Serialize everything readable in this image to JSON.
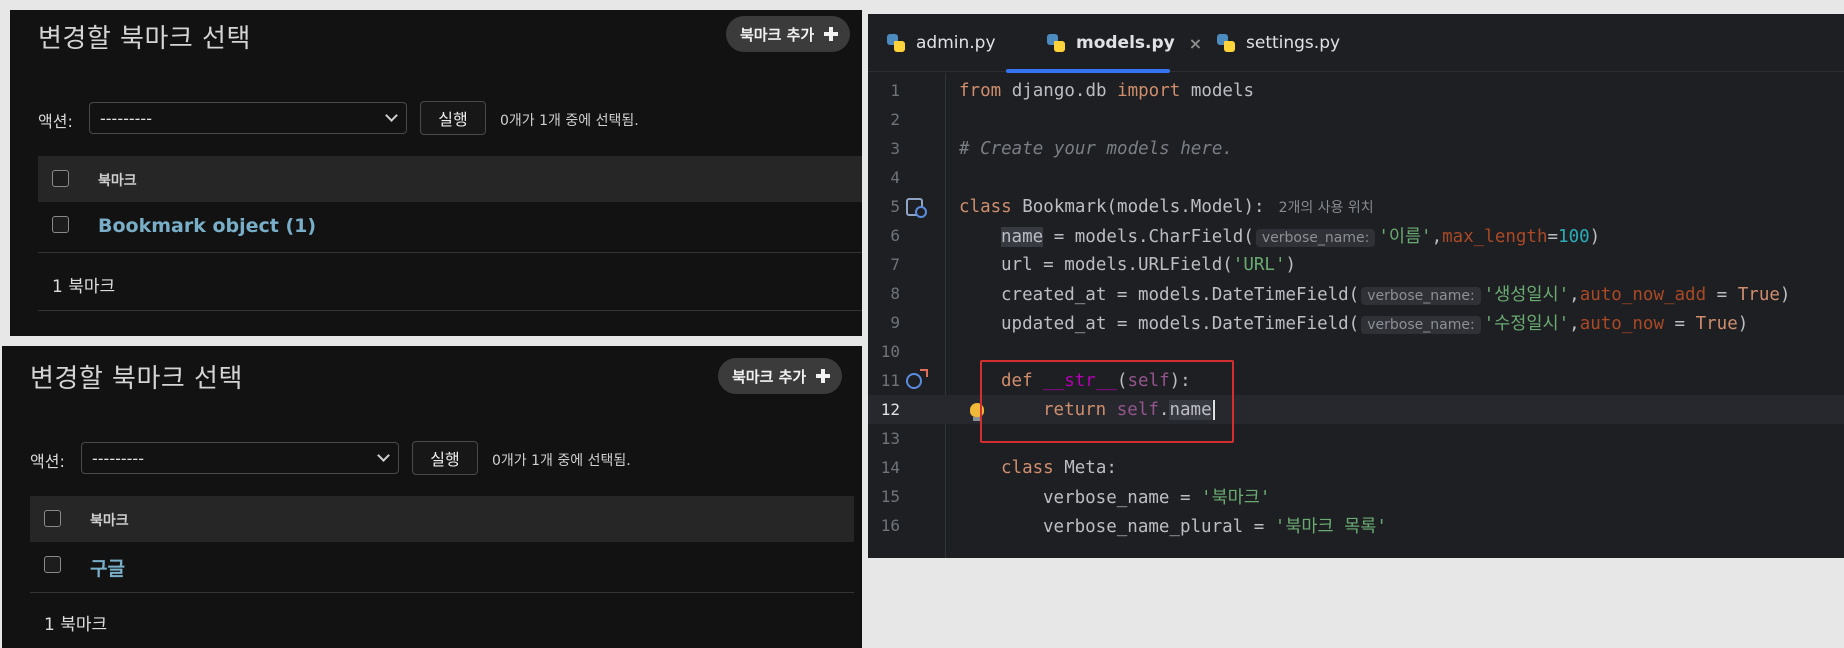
{
  "admin_top": {
    "title": "변경할 북마크 선택",
    "add_button": "북마크 추가",
    "action_label": "액션:",
    "action_value": "---------",
    "run_button": "실행",
    "selection_count": "0개가 1개 중에 선택됨.",
    "column_header": "북마크",
    "row": "Bookmark object (1)",
    "footer": "1 북마크"
  },
  "admin_bottom": {
    "title": "변경할 북마크 선택",
    "add_button": "북마크 추가",
    "action_label": "액션:",
    "action_value": "---------",
    "run_button": "실행",
    "selection_count": "0개가 1개 중에 선택됨.",
    "column_header": "북마크",
    "row": "구글",
    "footer": "1 북마크"
  },
  "editor": {
    "tabs": [
      {
        "label": "admin.py",
        "icon": "python-file-icon"
      },
      {
        "label": "models.py",
        "icon": "python-file-icon",
        "active": true
      },
      {
        "label": "settings.py",
        "icon": "python-file-icon"
      }
    ],
    "close_glyph": "×",
    "line_numbers": [
      "1",
      "2",
      "3",
      "4",
      "5",
      "6",
      "7",
      "8",
      "9",
      "10",
      "11",
      "12",
      "13",
      "14",
      "15",
      "16"
    ],
    "current_line": "12",
    "code": {
      "l1": {
        "t1": "from",
        "t2": " django.db ",
        "t3": "import",
        "t4": " models"
      },
      "l3": {
        "t1": "# Create your models here."
      },
      "l5": {
        "t1": "class",
        "t2": " Bookmark(models.Model):",
        "usage": "2개의 사용 위치"
      },
      "l6": {
        "t1": "name",
        "t2": " = models.CharField(",
        "hint": "verbose_name:",
        "t3": "'이름'",
        "t4": ",",
        "t5": "max_length",
        "t6": "=",
        "t7": "100",
        "t8": ")"
      },
      "l7": {
        "t1": "url = models.URLField(",
        "t2": "'URL'",
        "t3": ")"
      },
      "l8": {
        "t1": "created_at = models.DateTimeField(",
        "hint": "verbose_name:",
        "t2": "'생성일시'",
        "t3": ",",
        "t4": "auto_now_add",
        "t5": " = ",
        "t6": "True",
        "t7": ")"
      },
      "l9": {
        "t1": "updated_at = models.DateTimeField(",
        "hint": "verbose_name:",
        "t2": "'수정일시'",
        "t3": ",",
        "t4": "auto_now",
        "t5": " = ",
        "t6": "True",
        "t7": ")"
      },
      "l11": {
        "t1": "def",
        "t2": " ",
        "t3": "__str__",
        "t4": "(",
        "t5": "self",
        "t6": "):"
      },
      "l12": {
        "t1": "return",
        "t2": " ",
        "t3": "self",
        "t4": ".",
        "t5": "name"
      },
      "l14": {
        "t1": "class",
        "t2": " Meta:"
      },
      "l15": {
        "t1": "verbose_name = ",
        "t2": "'북마크'"
      },
      "l16": {
        "t1": "verbose_name_plural = ",
        "t2": "'북마크 목록'"
      }
    },
    "colors": {
      "keyword": "#cf8e6d",
      "string": "#6aab73",
      "number": "#2aacb8",
      "param": "#aa4926",
      "self": "#94558d",
      "dunder": "#b200b2",
      "annotation_box": "#d32f2f",
      "tab_underline": "#3574f0"
    }
  }
}
